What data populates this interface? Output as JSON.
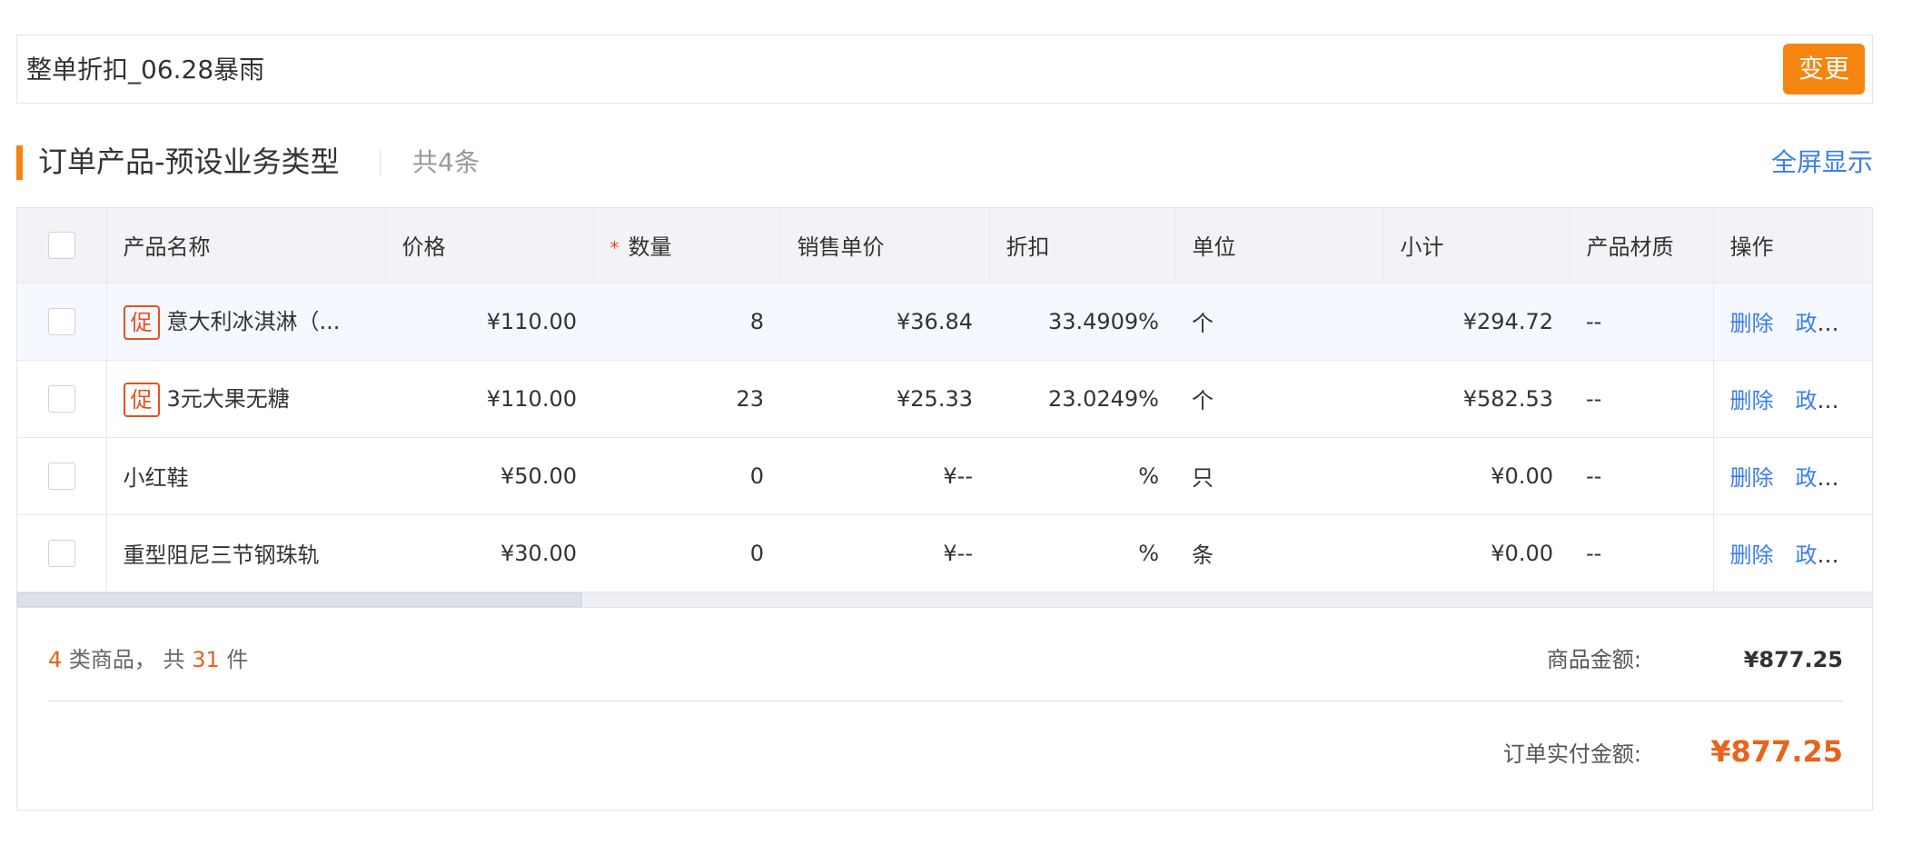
{
  "promotion": {
    "name": "整单折扣_06.28暴雨",
    "change_label": "变更"
  },
  "section": {
    "title": "订单产品-预设业务类型",
    "count": "共4条",
    "fullscreen_label": "全屏显示"
  },
  "table": {
    "headers": {
      "name": "产品名称",
      "price": "价格",
      "qty_required": "*",
      "qty": "数量",
      "unit_price": "销售单价",
      "discount": "折扣",
      "unit": "单位",
      "subtotal": "小计",
      "material": "产品材质",
      "ops": "操作"
    },
    "promo_tag": "促",
    "delete_label": "删除",
    "policy_label": "政策",
    "rows": [
      {
        "name": "意大利冰淇淋（...",
        "price": "¥110.00",
        "qty": "8",
        "unit_price": "¥36.84",
        "discount": "33.4909%",
        "unit": "个",
        "subtotal": "¥294.72",
        "material": "--"
      },
      {
        "name": "3元大果无糖",
        "price": "¥110.00",
        "qty": "23",
        "unit_price": "¥25.33",
        "discount": "23.0249%",
        "unit": "个",
        "subtotal": "¥582.53",
        "material": "--"
      },
      {
        "name": "小红鞋",
        "price": "¥50.00",
        "qty": "0",
        "unit_price": "¥--",
        "discount": "%",
        "unit": "只",
        "subtotal": "¥0.00",
        "material": "--"
      },
      {
        "name": "重型阻尼三节钢珠轨",
        "price": "¥30.00",
        "qty": "0",
        "unit_price": "¥--",
        "discount": "%",
        "unit": "条",
        "subtotal": "¥0.00",
        "material": "--"
      }
    ]
  },
  "summary": {
    "category_count": "4",
    "category_text": "类商品，  共",
    "item_count": "31",
    "item_unit": "件",
    "goods_amount_label": "商品金额:",
    "goods_amount": "¥877.25",
    "pay_amount_label": "订单实付金额:",
    "pay_amount": "¥877.25"
  },
  "colors": {
    "accent": "#f5850f",
    "link": "#3a7df0",
    "promo_red": "#e94f1f",
    "amount_orange": "#e9631a"
  }
}
